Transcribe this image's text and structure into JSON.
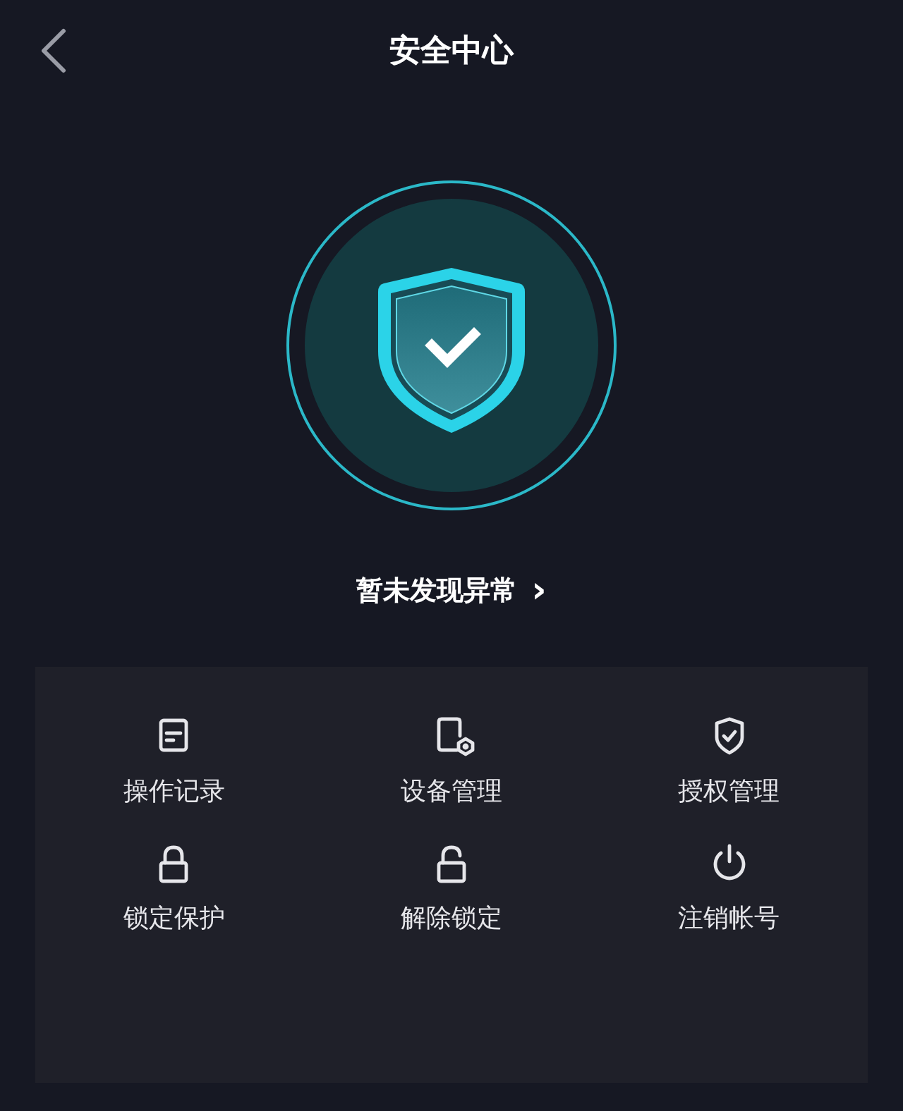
{
  "header": {
    "title": "安全中心"
  },
  "status": {
    "text": "暂未发现异常",
    "chevron": "›"
  },
  "actions": [
    {
      "label": "操作记录",
      "kind": "record"
    },
    {
      "label": "设备管理",
      "kind": "device"
    },
    {
      "label": "授权管理",
      "kind": "shield"
    },
    {
      "label": "锁定保护",
      "kind": "lock"
    },
    {
      "label": "解除锁定",
      "kind": "unlock"
    },
    {
      "label": "注销帐号",
      "kind": "power"
    }
  ]
}
